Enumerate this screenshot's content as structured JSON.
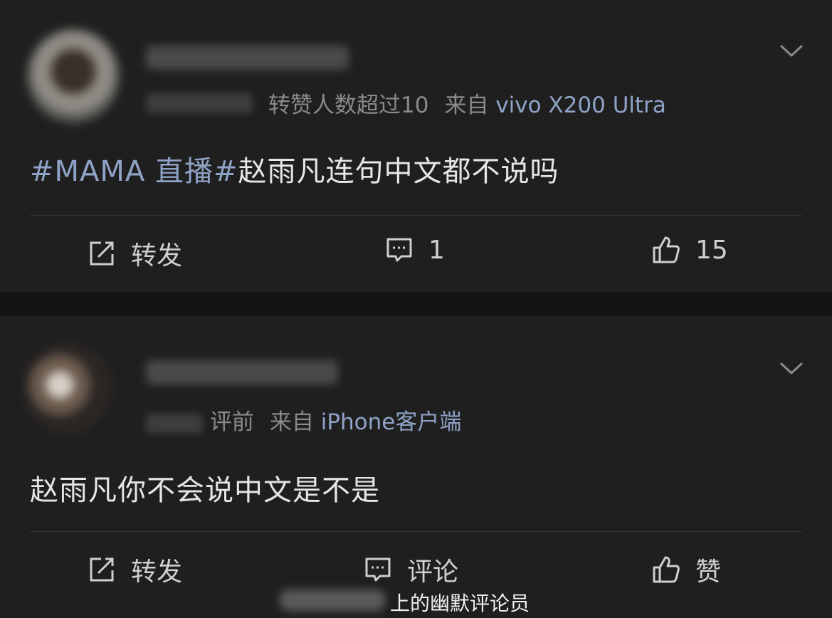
{
  "posts": [
    {
      "meta": {
        "note": "转赞人数超过10",
        "from_prefix": "来自",
        "device": "vivo X200 Ultra"
      },
      "content": {
        "topic": "#MAMA 直播#",
        "text": "赵雨凡连句中文都不说吗"
      },
      "actions": {
        "repost": "转发",
        "comment": "1",
        "like": "15"
      }
    },
    {
      "meta": {
        "time_suffix": "评前",
        "from_prefix": "来自",
        "device": "iPhone客户端"
      },
      "content": {
        "text": "赵雨凡你不会说中文是不是"
      },
      "actions": {
        "repost": "转发",
        "comment": "评论",
        "like": "赞"
      }
    }
  ],
  "watermark": {
    "text": "上的幽默评论员"
  },
  "icons": {
    "repost": "repost-icon",
    "comment": "comment-icon",
    "like": "thumbs-up-icon",
    "menu": "chevron-down-icon"
  },
  "colors": {
    "background": "#1f1f1f",
    "link": "#8fa3c7",
    "text": "#e6e6e6",
    "muted": "#8a8a8a"
  }
}
